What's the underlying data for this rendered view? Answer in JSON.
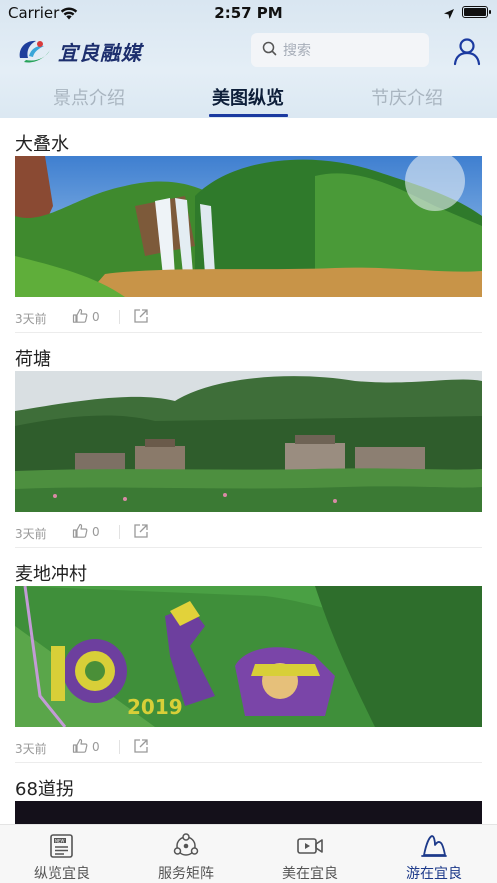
{
  "status_bar": {
    "carrier": "Carrier",
    "time": "2:57 PM"
  },
  "header": {
    "logo_text": "宜良融媒",
    "search_placeholder": "搜索"
  },
  "tabs": [
    {
      "label": "景点介绍"
    },
    {
      "label": "美图纵览"
    },
    {
      "label": "节庆介绍"
    }
  ],
  "active_tab": "美图纵览",
  "feed": [
    {
      "title": "大叠水",
      "time": "3天前",
      "likes": "0"
    },
    {
      "title": "荷塘",
      "time": "3天前",
      "likes": "0"
    },
    {
      "title": "麦地冲村",
      "time": "3天前",
      "likes": "0"
    },
    {
      "title": "68道拐"
    }
  ],
  "tab_bar": [
    {
      "label": "纵览宜良",
      "icon": "news-icon"
    },
    {
      "label": "服务矩阵",
      "icon": "service-matrix-icon"
    },
    {
      "label": "美在宜良",
      "icon": "video-icon"
    },
    {
      "label": "游在宜良",
      "icon": "travel-icon"
    }
  ],
  "active_bottom_tab": "游在宜良",
  "colors": {
    "accent": "#1b3aa0",
    "header_bg": "#dde9f3",
    "active_tab_text": "#0e1f3a"
  }
}
